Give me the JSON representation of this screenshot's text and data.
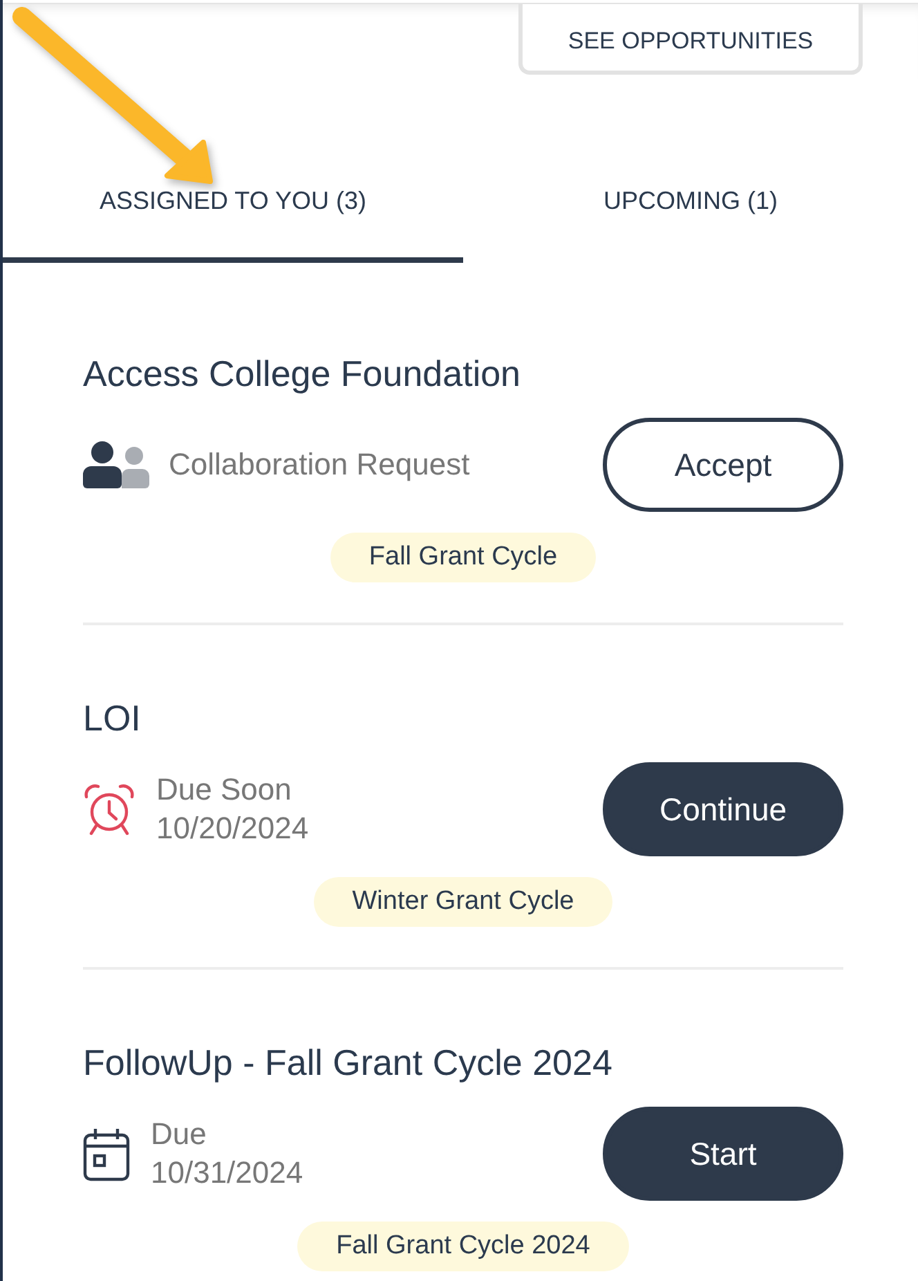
{
  "header": {
    "button": "SEE OPPORTUNITIES"
  },
  "callout": {
    "kind": "arrow"
  },
  "tabs": [
    {
      "label": "ASSIGNED TO YOU (3)",
      "selected": true
    },
    {
      "label": "UPCOMING (1)",
      "selected": false
    }
  ],
  "tasks": [
    {
      "title": "Access College Foundation",
      "kind": "collaboration",
      "status": "Collaboration Request",
      "action": "Accept",
      "tag": "Fall Grant Cycle"
    },
    {
      "title": "LOI",
      "kind": "due_soon",
      "status": "Due Soon",
      "date": "10/20/2024",
      "action": "Continue",
      "tag": "Winter Grant Cycle"
    },
    {
      "title": "FollowUp - Fall Grant Cycle 2024",
      "kind": "due",
      "status": "Due",
      "date": "10/31/2024",
      "action": "Start",
      "tag": "Fall Grant Cycle 2024"
    }
  ]
}
